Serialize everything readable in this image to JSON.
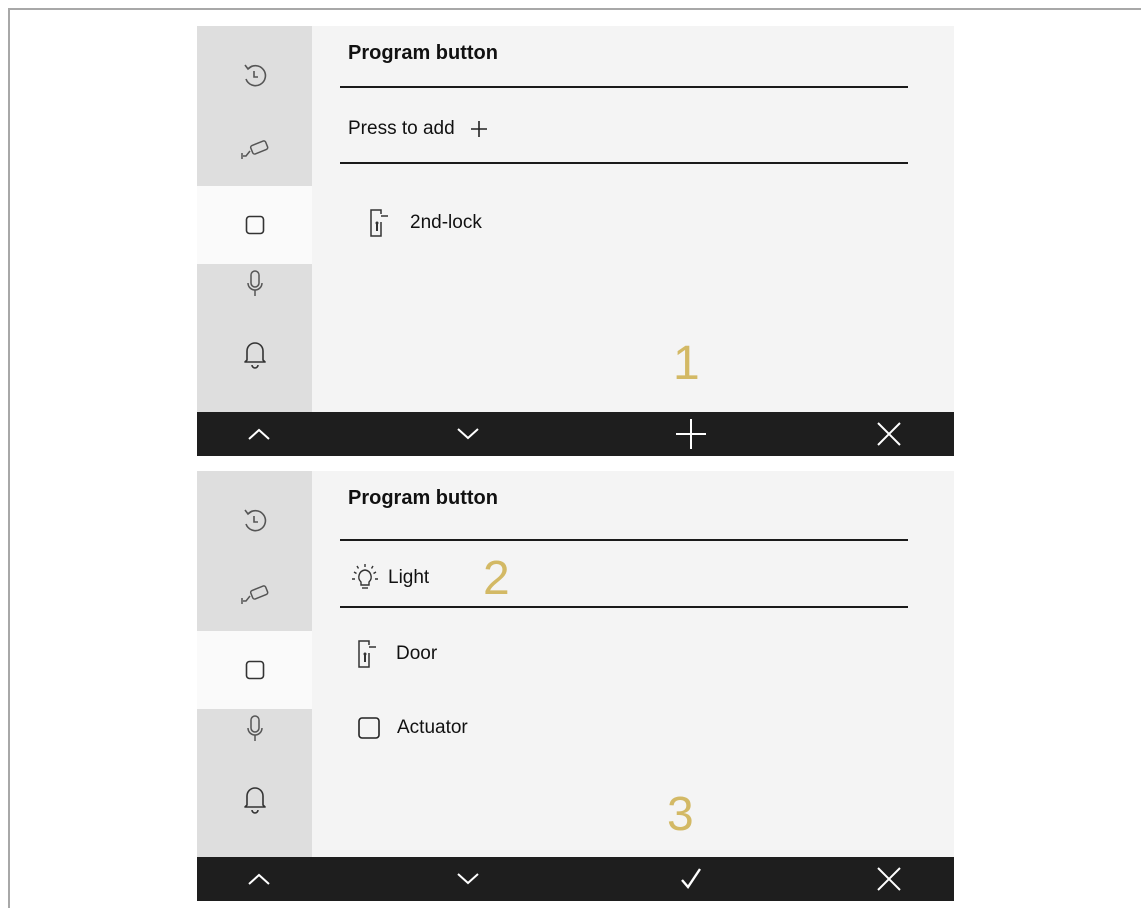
{
  "accent_color": "#d3b965",
  "panels": [
    {
      "title": "Program button",
      "add_row": {
        "label": "Press to add",
        "icon": "plus-icon"
      },
      "items": [
        {
          "label": "2nd-lock",
          "icon": "door-icon"
        }
      ],
      "step_number": "1",
      "toolbar": [
        "chevron-up-icon",
        "chevron-down-icon",
        "plus-icon",
        "close-icon"
      ]
    },
    {
      "title": "Program button",
      "items": [
        {
          "label": "Light",
          "icon": "lightbulb-icon",
          "selected": true
        },
        {
          "label": "Door",
          "icon": "door-icon"
        },
        {
          "label": "Actuator",
          "icon": "actuator-icon"
        }
      ],
      "step_number_selection": "2",
      "step_number": "3",
      "toolbar": [
        "chevron-up-icon",
        "chevron-down-icon",
        "checkmark-icon",
        "close-icon"
      ]
    }
  ],
  "sidebar_icons": [
    "history-icon",
    "camera-icon",
    "button-icon",
    "microphone-icon",
    "bell-icon"
  ]
}
